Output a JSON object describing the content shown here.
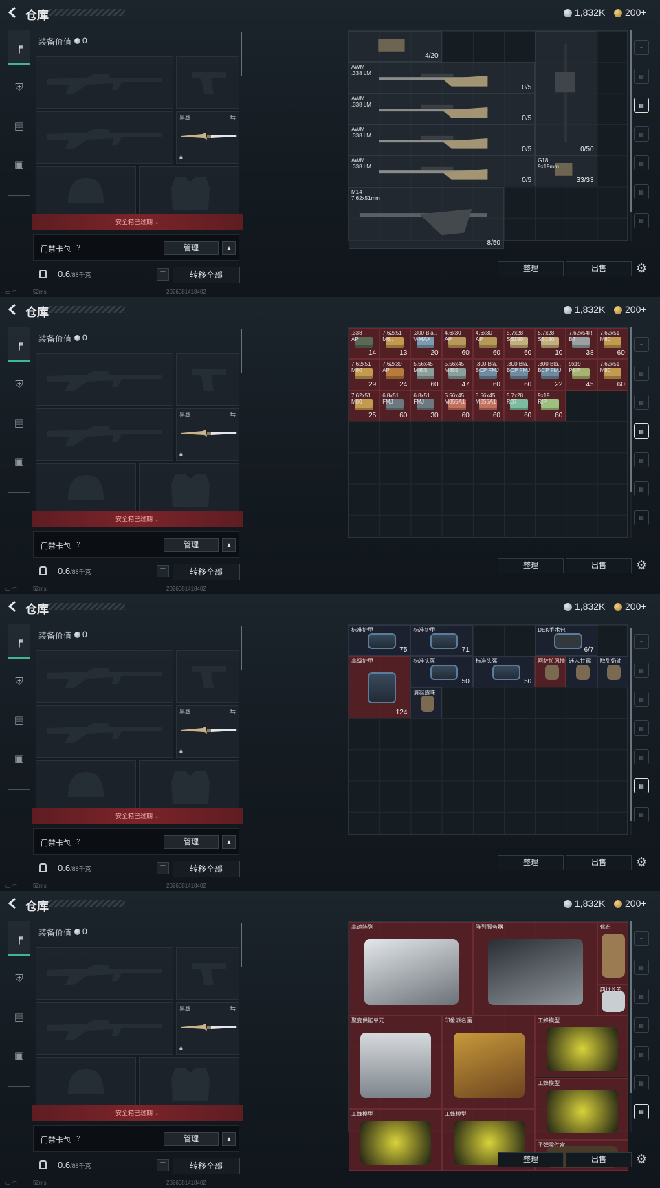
{
  "common": {
    "title": "仓库",
    "currency_silver": "1,832K",
    "currency_gold": "200+",
    "equip_label": "装备价值",
    "equip_value": "0",
    "knife_label": "黑鹰",
    "safebox_text": "安全箱已过期",
    "keybag_label": "门禁卡包",
    "help_label": "?",
    "manage_label": "管理",
    "weight_value": "0.6",
    "weight_max": "/88千克",
    "transfer_label": "转移全部",
    "sort_label": "整理",
    "sell_label": "出售",
    "ping": "52ms",
    "timestamp": "2026081418402"
  },
  "screens": [
    {
      "id": "weapons",
      "items": [
        {
          "name": "",
          "count": "4/20"
        },
        {
          "name": "AWM\n.338 LM",
          "count": "0/5"
        },
        {
          "name": "AWM\n.338 LM",
          "count": "0/5"
        },
        {
          "name": "AWM\n.338 LM",
          "count": "0/5"
        },
        {
          "name": "AWM\n.338 LM",
          "count": "0/5"
        },
        {
          "name": "",
          "count": "0/50"
        },
        {
          "name": "G18\n9x19mm",
          "count": "33/33"
        },
        {
          "name": "M14\n7.62x51mm",
          "count": "8/50"
        }
      ]
    },
    {
      "id": "ammo",
      "items": [
        {
          "name": ".338\nAP",
          "count": "14"
        },
        {
          "name": "7.62x51\nM6..",
          "count": "13"
        },
        {
          "name": ".300 Bla..\nV-MAX",
          "count": "20"
        },
        {
          "name": "4.6x30\nAP",
          "count": "60"
        },
        {
          "name": "4.6x30\nAP",
          "count": "60"
        },
        {
          "name": "5.7x28\nSS190",
          "count": "60"
        },
        {
          "name": "5.7x28\nSS190",
          "count": "10"
        },
        {
          "name": "7.62x54R\nBT",
          "count": "38"
        },
        {
          "name": "7.62x51\nM80",
          "count": "60"
        },
        {
          "name": "7.62x51\nM80",
          "count": "29"
        },
        {
          "name": "7.62x39\nAP",
          "count": "24"
        },
        {
          "name": "5.56x45\nM855",
          "count": "60"
        },
        {
          "name": "5.56x45\nM855",
          "count": "47"
        },
        {
          "name": ".300 Bla..\nBCP FMJ",
          "count": "60"
        },
        {
          "name": ".300 Bla..\nBCP FMJ",
          "count": "60"
        },
        {
          "name": ".300 Bla..\nBCP FMJ",
          "count": "22"
        },
        {
          "name": "9x19\nPBP",
          "count": "45"
        },
        {
          "name": "7.62x51\nM80",
          "count": "60"
        },
        {
          "name": "7.62x51\nM80",
          "count": "25"
        },
        {
          "name": "6.8x51\nFMJ",
          "count": "60"
        },
        {
          "name": "6.8x51\nFMJ",
          "count": "30"
        },
        {
          "name": "5.56x45\nM855A1",
          "count": "60"
        },
        {
          "name": "5.56x45\nM855A1",
          "count": "60"
        },
        {
          "name": "5.7x28\nR37",
          "count": "60"
        },
        {
          "name": "9x19\nRIP",
          "count": "60"
        }
      ]
    },
    {
      "id": "gear",
      "items": [
        {
          "name": "标准护甲",
          "count": "75"
        },
        {
          "name": "标准护甲",
          "count": "71"
        },
        {
          "name": "DEK手术包",
          "count": "6/7"
        },
        {
          "name": "高级护甲",
          "count": "124"
        },
        {
          "name": "标准头盔",
          "count": "50"
        },
        {
          "name": "标准头盔",
          "count": "50"
        },
        {
          "name": "阿萨拉风情",
          "count": ""
        },
        {
          "name": "迷人甘露",
          "count": ""
        },
        {
          "name": "醇甜奶油",
          "count": ""
        },
        {
          "name": "清凝露珠",
          "count": ""
        }
      ]
    },
    {
      "id": "valuables",
      "items": [
        {
          "name": "高速阵列",
          "count": ""
        },
        {
          "name": "阵列服务器",
          "count": ""
        },
        {
          "name": "化石",
          "count": ""
        },
        {
          "name": "典狱长的..",
          "count": ""
        },
        {
          "name": "聚变供能单元",
          "count": ""
        },
        {
          "name": "印象派名画",
          "count": ""
        },
        {
          "name": "工蜂模型",
          "count": ""
        },
        {
          "name": "工蜂模型",
          "count": ""
        },
        {
          "name": "工蜂模型",
          "count": ""
        },
        {
          "name": "工蜂模型",
          "count": ""
        },
        {
          "name": "子弹零件盒",
          "count": ""
        }
      ]
    }
  ]
}
